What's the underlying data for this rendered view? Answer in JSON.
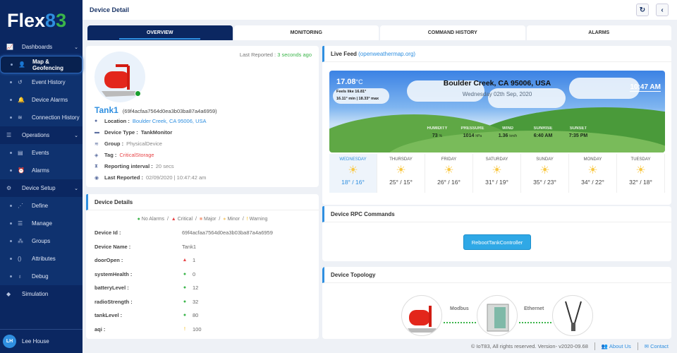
{
  "brand": {
    "logo": "Flex83"
  },
  "sidebar": {
    "sections": [
      {
        "label": "Dashboards",
        "icon": "chart-icon",
        "items": [
          {
            "label": "Map & Geofencing",
            "icon": "user-pin-icon",
            "active": true
          },
          {
            "label": "Event History",
            "icon": "history-icon"
          },
          {
            "label": "Device Alarms",
            "icon": "bell-icon"
          },
          {
            "label": "Connection History",
            "icon": "wifi-icon"
          }
        ]
      },
      {
        "label": "Operations",
        "icon": "list-icon",
        "items": [
          {
            "label": "Events",
            "icon": "clipboard-icon"
          },
          {
            "label": "Alarms",
            "icon": "alarm-icon"
          }
        ]
      },
      {
        "label": "Device Setup",
        "icon": "gears-icon",
        "items": [
          {
            "label": "Define",
            "icon": "nodes-icon"
          },
          {
            "label": "Manage",
            "icon": "list-icon"
          },
          {
            "label": "Groups",
            "icon": "groups-icon"
          },
          {
            "label": "Attributes",
            "icon": "braces-icon"
          },
          {
            "label": "Debug",
            "icon": "stethoscope-icon"
          }
        ]
      },
      {
        "label": "Simulation",
        "icon": "cube-icon",
        "items": []
      }
    ],
    "user": {
      "initials": "LH",
      "name": "Lee House"
    }
  },
  "header": {
    "title": "Device Detail"
  },
  "tabs": [
    "OVERVIEW",
    "MONITORING",
    "COMMAND HISTORY",
    "ALARMS"
  ],
  "device": {
    "last_reported_label": "Last Reported :",
    "last_reported_ago": "3 seconds ago",
    "name": "Tank1",
    "id_paren": "(69f4acfaa7564d0ea3b03ba87a4a6959)",
    "location_label": "Location :",
    "location": "Boulder Creek, CA 95006, USA",
    "type_label": "Device Type :",
    "type": "TankMonitor",
    "group_label": "Group :",
    "group": "PhysicalDevice",
    "tag_label": "Tag :",
    "tag": "CriticalStorage",
    "interval_label": "Reporting interval :",
    "interval": "20 secs",
    "last_label": "Last Reported :",
    "last": "02/09/2020 | 10:47:42 am"
  },
  "details": {
    "title": "Device Details",
    "legend": [
      "No Alarms",
      "Critical",
      "Major",
      "Minor",
      "Warning"
    ],
    "rows": [
      {
        "k": "Device Id :",
        "v": "69f4acfaa7564d0ea3b03ba87a4a6959",
        "s": ""
      },
      {
        "k": "Device Name :",
        "v": "Tank1",
        "s": ""
      },
      {
        "k": "doorOpen :",
        "v": "1",
        "s": "crit"
      },
      {
        "k": "systemHealth :",
        "v": "0",
        "s": "ok"
      },
      {
        "k": "batteryLevel :",
        "v": "12",
        "s": "ok"
      },
      {
        "k": "radioStrength :",
        "v": "32",
        "s": "ok"
      },
      {
        "k": "tankLevel :",
        "v": "80",
        "s": "ok"
      },
      {
        "k": "aqi :",
        "v": "100",
        "s": "warn"
      }
    ]
  },
  "live": {
    "title": "Live Feed",
    "source": "(openweathermap.org)",
    "temp": "17.08",
    "unit": "°C",
    "feels": "Feels like 16.81°",
    "minmax": "16.11° min  |  18.33° max",
    "location": "Boulder Creek, CA 95006, USA",
    "date": "Wednesday 02th Sep, 2020",
    "time": "10:47 AM",
    "stats": [
      {
        "l": "HUMIDITY",
        "v": "73",
        "u": "%"
      },
      {
        "l": "PRESSURE",
        "v": "1014",
        "u": "hPa"
      },
      {
        "l": "WIND",
        "v": "1.36",
        "u": "km/h"
      },
      {
        "l": "SUNRISE",
        "v": "6:40 AM",
        "u": ""
      },
      {
        "l": "SUNSET",
        "v": "7:35 PM",
        "u": ""
      }
    ],
    "forecast": [
      {
        "d": "WEDNESDAY",
        "t": "18° / 16°"
      },
      {
        "d": "THURSDAY",
        "t": "25° / 15°"
      },
      {
        "d": "FRIDAY",
        "t": "26° / 16°"
      },
      {
        "d": "SATURDAY",
        "t": "31° / 19°"
      },
      {
        "d": "SUNDAY",
        "t": "35° / 23°"
      },
      {
        "d": "MONDAY",
        "t": "34° / 22°"
      },
      {
        "d": "TUESDAY",
        "t": "32° / 18°"
      }
    ]
  },
  "rpc": {
    "title": "Device RPC Commands",
    "button": "RebootTankController"
  },
  "topology": {
    "title": "Device Topology",
    "links": [
      "Modbus",
      "Ethernet"
    ]
  },
  "footer": {
    "copyright": "© IoT83, All rights reserved. Version- v2020-09.68",
    "about": "About Us",
    "contact": "Contact"
  }
}
